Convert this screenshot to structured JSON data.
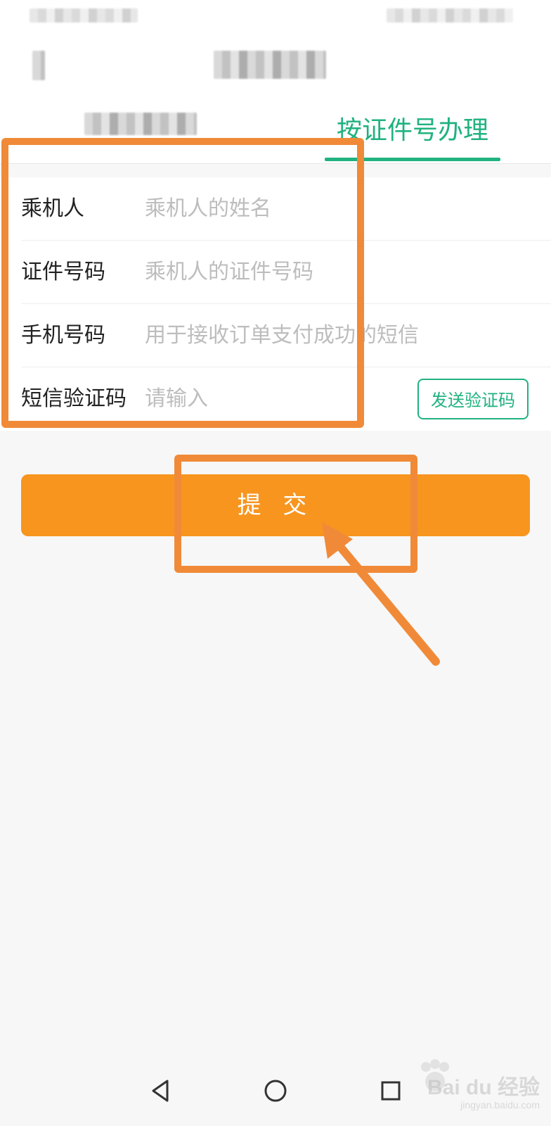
{
  "tabs": {
    "active_label": "按证件号办理"
  },
  "form": {
    "rows": [
      {
        "label": "乘机人",
        "placeholder": "乘机人的姓名"
      },
      {
        "label": "证件号码",
        "placeholder": "乘机人的证件号码"
      },
      {
        "label": "手机号码",
        "placeholder": "用于接收订单支付成功的短信"
      },
      {
        "label": "短信验证码",
        "placeholder": "请输入"
      }
    ],
    "send_code_label": "发送验证码"
  },
  "actions": {
    "submit_label": "提 交"
  },
  "colors": {
    "accent_green": "#20b27f",
    "primary_orange": "#f7951f",
    "annotation_orange": "#f08a38"
  },
  "system_nav": {
    "icons": [
      "back-icon",
      "home-icon",
      "recents-icon"
    ]
  },
  "watermark": {
    "brand": "Bai du 经验",
    "url": "jingyan.baidu.com"
  }
}
